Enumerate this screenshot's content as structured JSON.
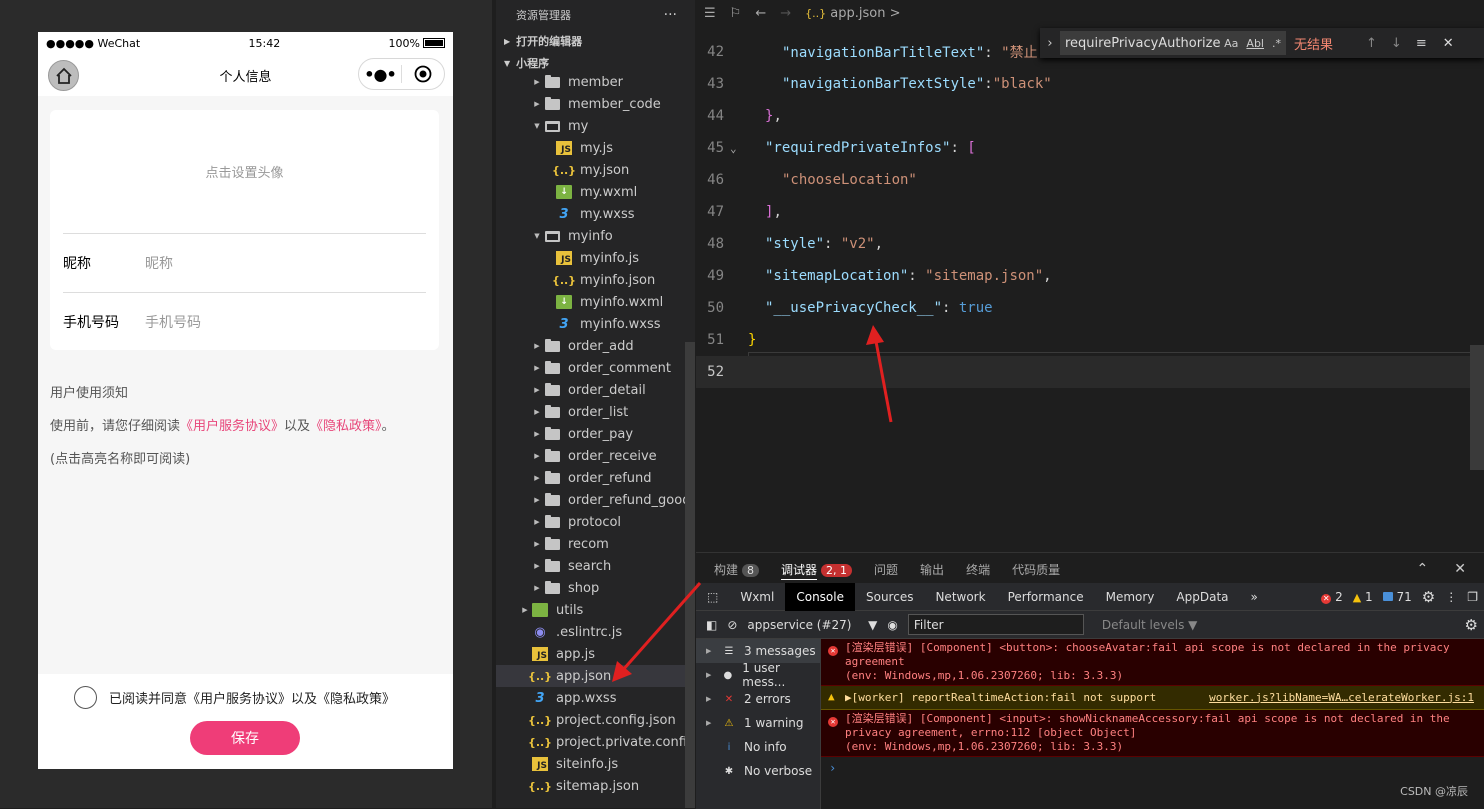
{
  "simulator": {
    "status": {
      "carrier": "●●●●● WeChat",
      "time": "15:42",
      "battery": "100%"
    },
    "nav_title": "个人信息",
    "avatar_hint": "点击设置头像",
    "nickname": {
      "label": "昵称",
      "placeholder": "昵称"
    },
    "phone": {
      "label": "手机号码",
      "placeholder": "手机号码"
    },
    "notice": {
      "title": "用户使用须知",
      "line_prefix": "使用前，请您仔细阅读",
      "link1": "《用户服务协议》",
      "mid": "以及",
      "link2": "《隐私政策》",
      "line_suffix": "。",
      "hint": "(点击高亮名称即可阅读)"
    },
    "agree_text": "已阅读并同意《用户服务协议》以及《隐私政策》",
    "save_label": "保存"
  },
  "explorer": {
    "title": "资源管理器",
    "more": "···",
    "open_editors": "打开的编辑器",
    "project": "小程序",
    "items": [
      {
        "label": "member",
        "type": "folder",
        "indent": 1,
        "arrow": "▶"
      },
      {
        "label": "member_code",
        "type": "folder",
        "indent": 1,
        "arrow": "▶"
      },
      {
        "label": "my",
        "type": "folder-open",
        "indent": 1,
        "arrow": "▼"
      },
      {
        "label": "my.js",
        "type": "js",
        "indent": 2
      },
      {
        "label": "my.json",
        "type": "json",
        "indent": 2
      },
      {
        "label": "my.wxml",
        "type": "wxml",
        "indent": 2
      },
      {
        "label": "my.wxss",
        "type": "wxss",
        "indent": 2
      },
      {
        "label": "myinfo",
        "type": "folder-open",
        "indent": 1,
        "arrow": "▼"
      },
      {
        "label": "myinfo.js",
        "type": "js",
        "indent": 2
      },
      {
        "label": "myinfo.json",
        "type": "json",
        "indent": 2
      },
      {
        "label": "myinfo.wxml",
        "type": "wxml",
        "indent": 2
      },
      {
        "label": "myinfo.wxss",
        "type": "wxss",
        "indent": 2
      },
      {
        "label": "order_add",
        "type": "folder",
        "indent": 1,
        "arrow": "▶"
      },
      {
        "label": "order_comment",
        "type": "folder",
        "indent": 1,
        "arrow": "▶"
      },
      {
        "label": "order_detail",
        "type": "folder",
        "indent": 1,
        "arrow": "▶"
      },
      {
        "label": "order_list",
        "type": "folder",
        "indent": 1,
        "arrow": "▶"
      },
      {
        "label": "order_pay",
        "type": "folder",
        "indent": 1,
        "arrow": "▶"
      },
      {
        "label": "order_receive",
        "type": "folder",
        "indent": 1,
        "arrow": "▶"
      },
      {
        "label": "order_refund",
        "type": "folder",
        "indent": 1,
        "arrow": "▶"
      },
      {
        "label": "order_refund_goods",
        "type": "folder",
        "indent": 1,
        "arrow": "▶"
      },
      {
        "label": "protocol",
        "type": "folder",
        "indent": 1,
        "arrow": "▶"
      },
      {
        "label": "recom",
        "type": "folder",
        "indent": 1,
        "arrow": "▶"
      },
      {
        "label": "search",
        "type": "folder",
        "indent": 1,
        "arrow": "▶"
      },
      {
        "label": "shop",
        "type": "folder",
        "indent": 1,
        "arrow": "▶"
      },
      {
        "label": "utils",
        "type": "utils",
        "indent": 0,
        "arrow": "▶"
      },
      {
        "label": ".eslintrc.js",
        "type": "lint",
        "indent": 0
      },
      {
        "label": "app.js",
        "type": "js",
        "indent": 0
      },
      {
        "label": "app.json",
        "type": "json",
        "indent": 0,
        "selected": true
      },
      {
        "label": "app.wxss",
        "type": "wxss",
        "indent": 0
      },
      {
        "label": "project.config.json",
        "type": "json",
        "indent": 0
      },
      {
        "label": "project.private.config.js...",
        "type": "json",
        "indent": 0
      },
      {
        "label": "siteinfo.js",
        "type": "js",
        "indent": 0
      },
      {
        "label": "sitemap.json",
        "type": "json",
        "indent": 0
      }
    ]
  },
  "editor": {
    "breadcrumb_file": "app.json",
    "breadcrumb_sep": ">",
    "find": {
      "query": "requirePrivacyAuthorize",
      "case": "Aa",
      "word": "Abl",
      "regex": ".*",
      "result": "无结果"
    },
    "lines": [
      {
        "num": "42",
        "indent": 2,
        "html": "<span class='k'>\"navigationBarTitleText\"</span><span class='p'>: </span><span class='s'>\"禁止</span>"
      },
      {
        "num": "43",
        "indent": 2,
        "html": "<span class='k'>\"navigationBarTextStyle\"</span><span class='p'>:</span><span class='s'>\"black\"</span>"
      },
      {
        "num": "44",
        "indent": 1,
        "html": "<span class='b2'>}</span><span class='p'>,</span>"
      },
      {
        "num": "45",
        "indent": 1,
        "html": "<span class='k'>\"requiredPrivateInfos\"</span><span class='p'>: </span><span class='b2'>[</span>"
      },
      {
        "num": "46",
        "indent": 2,
        "html": "<span class='s'>\"chooseLocation\"</span>"
      },
      {
        "num": "47",
        "indent": 1,
        "html": "<span class='b2'>]</span><span class='p'>,</span>"
      },
      {
        "num": "48",
        "indent": 1,
        "html": "<span class='k'>\"style\"</span><span class='p'>: </span><span class='s'>\"v2\"</span><span class='p'>,</span>"
      },
      {
        "num": "49",
        "indent": 1,
        "html": "<span class='k'>\"sitemapLocation\"</span><span class='p'>: </span><span class='s'>\"sitemap.json\"</span><span class='p'>,</span>"
      },
      {
        "num": "50",
        "indent": 1,
        "html": "<span class='k'>\"__usePrivacyCheck__\"</span><span class='p'>: </span><span class='kw'>true</span>"
      },
      {
        "num": "51",
        "indent": 0,
        "html": "<span class='b'>}</span>"
      },
      {
        "num": "52",
        "indent": 0,
        "html": "",
        "current": true
      }
    ]
  },
  "panel": {
    "tabs": [
      {
        "label": "构建",
        "badge": "8"
      },
      {
        "label": "调试器",
        "badge": "2, 1",
        "active": true
      },
      {
        "label": "问题"
      },
      {
        "label": "输出"
      },
      {
        "label": "终端"
      },
      {
        "label": "代码质量"
      }
    ],
    "devtools_tabs": [
      "Wxml",
      "Console",
      "Sources",
      "Network",
      "Performance",
      "Memory",
      "AppData"
    ],
    "devtools_active": "Console",
    "devtools_more": "»",
    "status_errors": "2",
    "status_warnings": "1",
    "status_info": "71",
    "context": "appservice (#27)",
    "filter_placeholder": "Filter",
    "levels": "Default levels ▼",
    "sidebar": [
      {
        "label": "3 messages",
        "icon": "☰",
        "active": true
      },
      {
        "label": "1 user mess...",
        "icon": "●"
      },
      {
        "label": "2 errors",
        "icon": "✕",
        "color": "#e53935"
      },
      {
        "label": "1 warning",
        "icon": "⚠",
        "color": "#f4c20d"
      },
      {
        "label": "No info",
        "icon": "i",
        "color": "#4a90d9"
      },
      {
        "label": "No verbose",
        "icon": "✱"
      }
    ],
    "logs": [
      {
        "level": "err",
        "text": "[渲染层错误] [Component] <button>: chooseAvatar:fail api scope is not declared in the privacy agreement\n(env: Windows,mp,1.06.2307260; lib: 3.3.3)"
      },
      {
        "level": "warn",
        "text": "▶[worker] reportRealtimeAction:fail not support",
        "link": "worker.js?libName=WA…celerateWorker.js:1"
      },
      {
        "level": "err",
        "text": "[渲染层错误] [Component] <input>: showNicknameAccessory:fail api scope is not declared in the privacy agreement, errno:112 [object Object]\n(env: Windows,mp,1.06.2307260; lib: 3.3.3)"
      }
    ],
    "prompt": "›"
  },
  "watermark": "CSDN @凉辰",
  "colors": {
    "accent": "#ef3d78",
    "annotation": "#e02020"
  }
}
